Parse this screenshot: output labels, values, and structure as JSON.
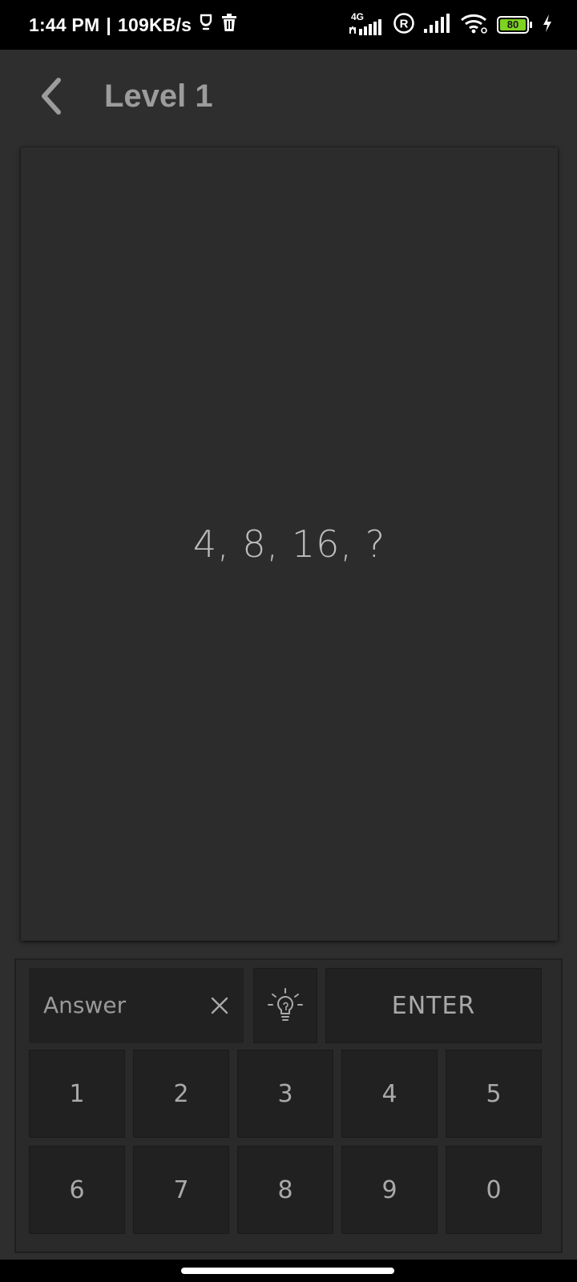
{
  "status_bar": {
    "time": "1:44 PM",
    "separator": "|",
    "net_speed": "109KB/s",
    "network_type": "4G",
    "battery_level": "80",
    "icons": [
      "clipboard-icon",
      "trash-icon",
      "signal-4g-icon",
      "registered-icon",
      "signal-icon",
      "wifi-icon",
      "battery-icon",
      "charging-icon"
    ]
  },
  "toolbar": {
    "back_icon": "chevron-left-icon",
    "title": "Level 1"
  },
  "puzzle": {
    "question": "4, 8, 16, ?"
  },
  "keypad": {
    "answer_placeholder": "Answer",
    "clear_icon": "close-icon",
    "hint_icon": "lightbulb-icon",
    "enter_label": "ENTER",
    "digits_row1": [
      "1",
      "2",
      "3",
      "4",
      "5"
    ],
    "digits_row2": [
      "6",
      "7",
      "8",
      "9",
      "0"
    ]
  },
  "colors": {
    "background": "#2e2e2e",
    "card": "#2c2c2c",
    "key": "#212121",
    "text": "#a9a9a9",
    "battery_accent": "#7ed321"
  }
}
